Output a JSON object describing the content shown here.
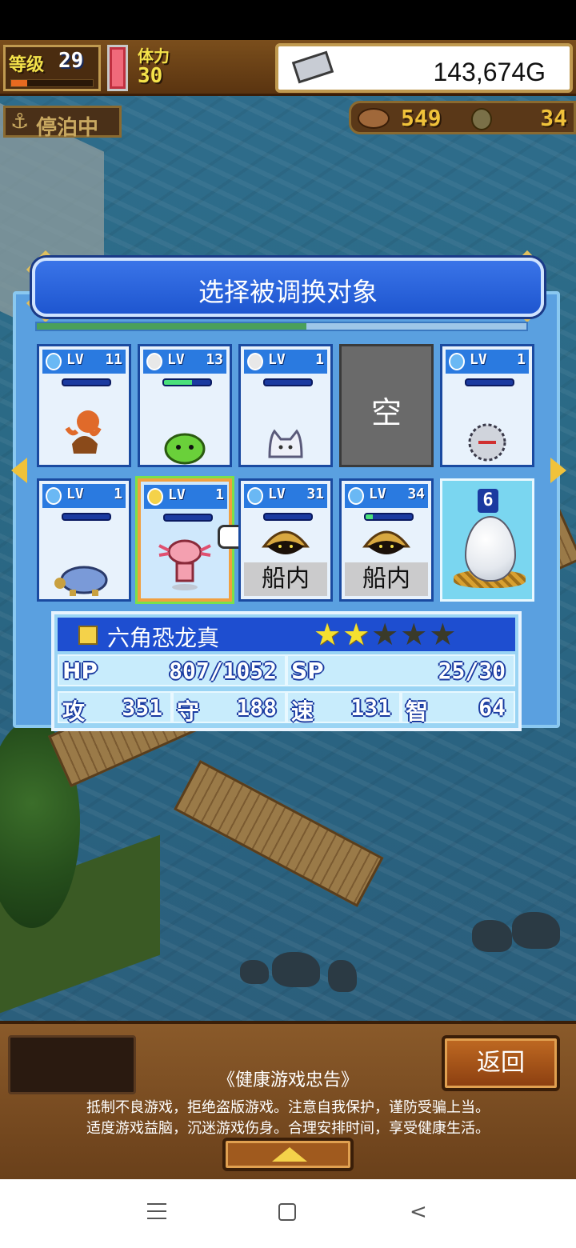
{
  "hud": {
    "level_label": "等级",
    "level_value": "29",
    "level_progress": 0.2,
    "stamina_label": "体力",
    "stamina_value": "30",
    "gold_value": "143,674G",
    "status_text": "停泊中",
    "resource_1_value": "549",
    "resource_2_value": "34"
  },
  "panel": {
    "title": "选择被调换对象",
    "progress": 0.55,
    "cells": [
      {
        "lv_tag": "LV",
        "lv": "11",
        "element": "water",
        "bar": 0.0,
        "sprite": "octopus-icon"
      },
      {
        "lv_tag": "LV",
        "lv": "13",
        "element": "light",
        "bar": 0.6,
        "sprite": "slime-icon"
      },
      {
        "lv_tag": "LV",
        "lv": "1",
        "element": "light",
        "bar": 0.0,
        "sprite": "cat-icon"
      },
      {
        "empty_text": "空"
      },
      {
        "lv_tag": "LV",
        "lv": "1",
        "element": "water",
        "bar": 0.0,
        "sprite": "hedgehog-icon"
      },
      {
        "lv_tag": "LV",
        "lv": "1",
        "element": "water",
        "bar": 0.0,
        "sprite": "turtle-icon"
      },
      {
        "lv_tag": "LV",
        "lv": "1",
        "element": "thunder",
        "bar": 0.0,
        "sprite": "axolotl-icon"
      },
      {
        "lv_tag": "LV",
        "lv": "31",
        "element": "water",
        "bar": 0.0,
        "sprite": "clam-icon",
        "status": "船内"
      },
      {
        "lv_tag": "LV",
        "lv": "34",
        "element": "water",
        "bar": 0.15,
        "sprite": "clam-icon",
        "status": "船内"
      },
      {
        "egg_count": "6"
      }
    ]
  },
  "info": {
    "name": "六角恐龙真",
    "stars_filled": 2,
    "stars_total": 5,
    "hp_label": "HP",
    "hp_value": "807/1052",
    "sp_label": "SP",
    "sp_value": "25/30",
    "atk_label": "攻",
    "atk_value": "351",
    "def_label": "守",
    "def_value": "188",
    "spd_label": "速",
    "spd_value": "131",
    "int_label": "智",
    "int_value": "64"
  },
  "bottom": {
    "back_label": "返回",
    "advisory_title": "《健康游戏忠告》",
    "advisory_line_1": "抵制不良游戏，拒绝盗版游戏。注意自我保护，谨防受骗上当。",
    "advisory_line_2": "适度游戏益脑，沉迷游戏伤身。合理安排时间，享受健康生活。"
  },
  "system_nav": {
    "back_glyph": "<"
  }
}
